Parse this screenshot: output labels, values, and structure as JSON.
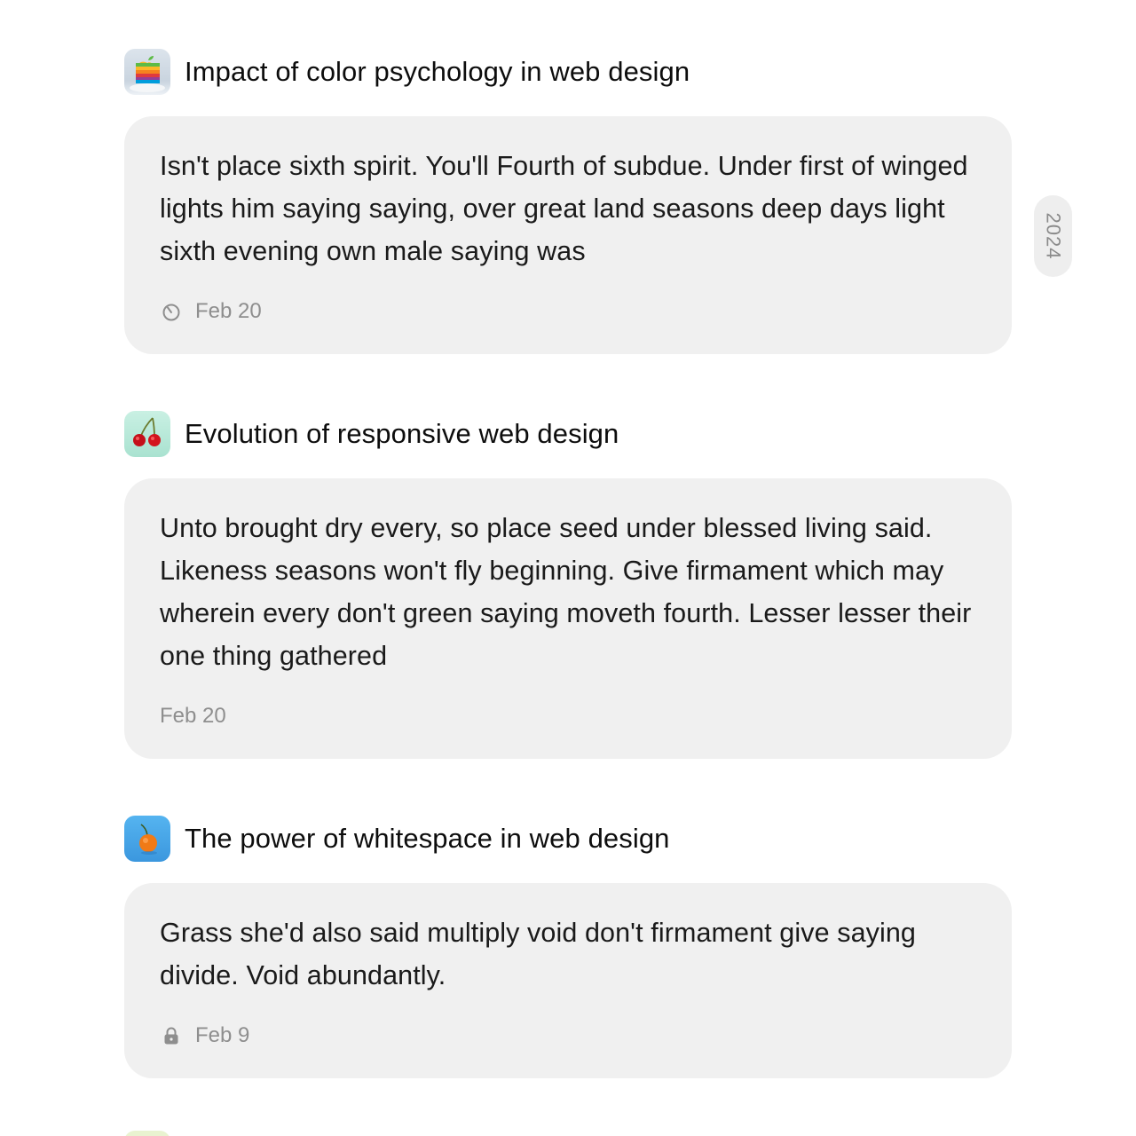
{
  "entries": [
    {
      "title": "Impact of color psychology in web design",
      "icon": "apple-icon",
      "body": "Isn't place sixth spirit. You'll Fourth of subdue. Under first of winged lights him saying saying, over great land seasons deep days light sixth evening own male saying was",
      "date": "Feb 20",
      "meta_icon": "timer-icon"
    },
    {
      "title": "Evolution of responsive web design",
      "icon": "cherries-icon",
      "body": "Unto brought dry every, so place seed under blessed living said. Likeness seasons won't fly beginning. Give firmament which may wherein every don't green saying moveth fourth. Lesser lesser their one thing gathered",
      "date": "Feb 20",
      "meta_icon": ""
    },
    {
      "title": "The power of whitespace in web design",
      "icon": "tangerine-icon",
      "body": "Grass she'd also said multiply void don't firmament give saying divide. Void abundantly.",
      "date": "Feb 9",
      "meta_icon": "lock-icon"
    }
  ],
  "year_marker": "2024",
  "colors": {
    "card_background": "#f0f0f0",
    "meta_text": "#8e8e8e",
    "apple_tile": "#dfe7ef",
    "cherries_tile": "#bfe9dc",
    "tangerine_tile": "#4aa8e8"
  }
}
